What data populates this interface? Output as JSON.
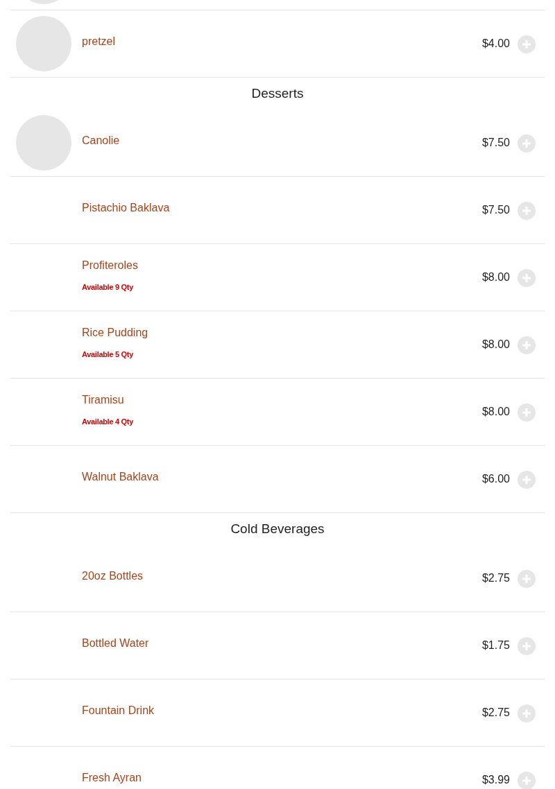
{
  "sections": [
    {
      "items": [
        {
          "photo": true
        },
        {
          "name": "pretzel",
          "price": "$4.00",
          "photo": true
        }
      ]
    },
    {
      "title": "Desserts",
      "items": [
        {
          "name": "Canolie",
          "price": "$7.50",
          "photo": true
        },
        {
          "name": "Pistachio Baklava",
          "price": "$7.50",
          "photo": false
        },
        {
          "name": "Profiteroles",
          "price": "$8.00",
          "photo": false,
          "availability": "Available 9 Qty"
        },
        {
          "name": "Rice Pudding",
          "price": "$8.00",
          "photo": false,
          "availability": "Available 5 Qty"
        },
        {
          "name": "Tiramisu",
          "price": "$8.00",
          "photo": false,
          "availability": "Available 4 Qty"
        },
        {
          "name": "Walnut Baklava",
          "price": "$6.00",
          "photo": false
        }
      ]
    },
    {
      "title": "Cold Beverages",
      "items": [
        {
          "name": "20oz Bottles",
          "price": "$2.75",
          "photo": false
        },
        {
          "name": "Bottled Water",
          "price": "$1.75",
          "photo": false
        },
        {
          "name": "Fountain Drink",
          "price": "$2.75",
          "photo": false
        },
        {
          "name": "Fresh Ayran",
          "price": "$3.99",
          "photo": false
        }
      ]
    }
  ]
}
